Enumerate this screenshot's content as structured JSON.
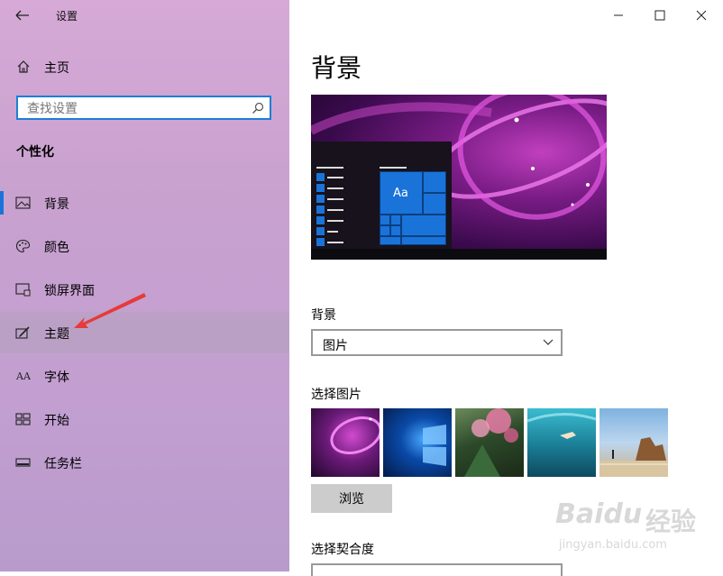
{
  "app": {
    "title": "设置"
  },
  "sidebar": {
    "home_label": "主页",
    "search_placeholder": "查找设置",
    "section_title": "个性化",
    "items": [
      {
        "label": "背景",
        "icon": "picture-icon",
        "active": true
      },
      {
        "label": "颜色",
        "icon": "palette-icon"
      },
      {
        "label": "锁屏界面",
        "icon": "lock-screen-icon"
      },
      {
        "label": "主题",
        "icon": "theme-brush-icon",
        "hovered": true
      },
      {
        "label": "字体",
        "icon": "font-icon",
        "glyph": "AA"
      },
      {
        "label": "开始",
        "icon": "start-tiles-icon"
      },
      {
        "label": "任务栏",
        "icon": "taskbar-icon"
      }
    ]
  },
  "content": {
    "page_title": "背景",
    "preview": {
      "tile_label": "Aa"
    },
    "background_label": "背景",
    "background_value": "图片",
    "choose_picture_label": "选择图片",
    "thumbnails": [
      "purple-swirl",
      "windows-blue",
      "pink-blossom",
      "underwater-swimmer",
      "beach-rocks"
    ],
    "browse_label": "浏览",
    "fit_label": "选择契合度"
  },
  "watermark": {
    "brand": "Baidu",
    "brand_cn": "经验",
    "url": "jingyan.baidu.com"
  },
  "colors": {
    "accent": "#1a73d9",
    "sidebar_bg": "#c8a1cf",
    "active_indicator": "#1a73d9"
  }
}
